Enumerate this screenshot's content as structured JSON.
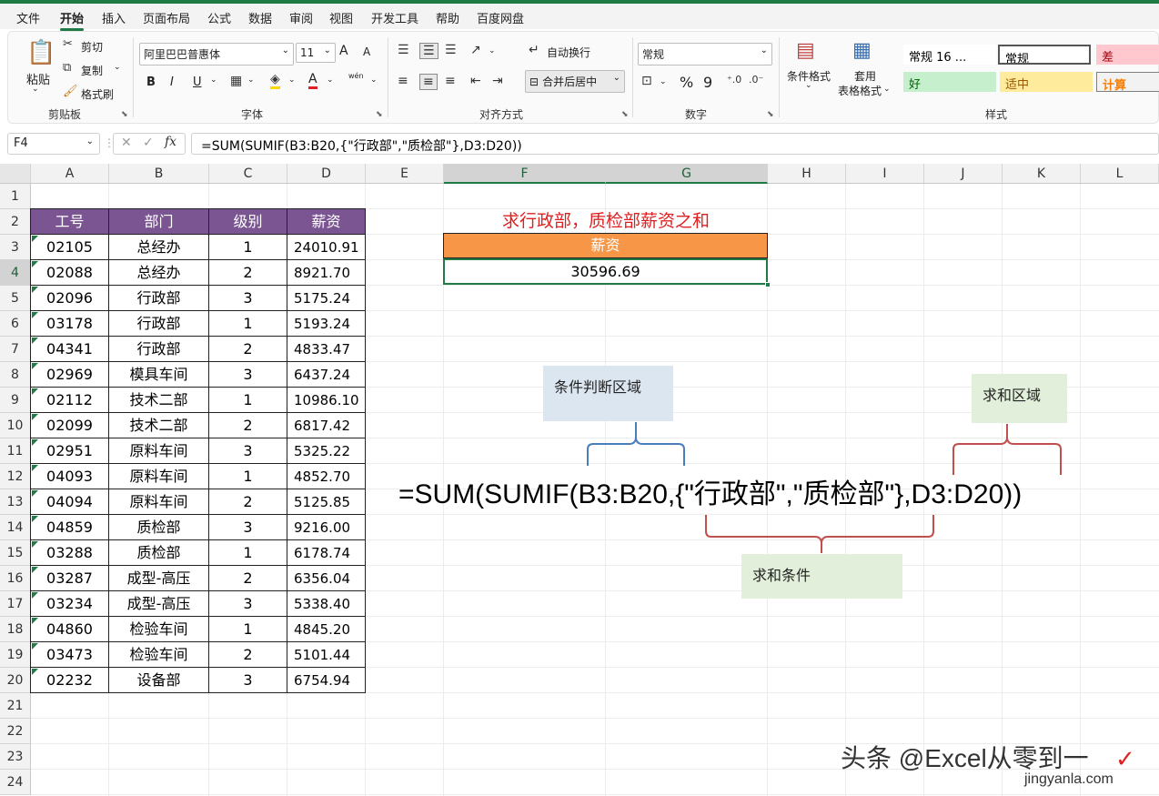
{
  "menu": [
    "文件",
    "开始",
    "插入",
    "页面布局",
    "公式",
    "数据",
    "审阅",
    "视图",
    "开发工具",
    "帮助",
    "百度网盘"
  ],
  "ribbon": {
    "clipboard": {
      "paste": "粘贴",
      "cut": "剪切",
      "copy": "复制",
      "format_painter": "格式刷",
      "label": "剪贴板"
    },
    "font": {
      "family": "阿里巴巴普惠体",
      "size": "11",
      "grow": "A",
      "shrink": "A",
      "bold": "B",
      "italic": "I",
      "underline": "U",
      "font_color_letter": "A",
      "phonetic": "wén",
      "label": "字体"
    },
    "alignment": {
      "wrap": "自动换行",
      "merge": "合并后居中",
      "label": "对齐方式"
    },
    "number": {
      "format": "常规",
      "percent": "%",
      "comma": "9",
      "label": "数字"
    },
    "styles": {
      "conditional": "条件格式",
      "table_fmt_1": "套用",
      "table_fmt_2": "表格格式",
      "cells": [
        {
          "text": "常规 16 ...",
          "bg": "#ffffff",
          "color": "#000000"
        },
        {
          "text": "常规",
          "bg": "#ffffff",
          "color": "#000000"
        },
        {
          "text": "差",
          "bg": "#ffc7ce",
          "color": "#9c0006"
        },
        {
          "text": "好",
          "bg": "#c6efce",
          "color": "#006100"
        },
        {
          "text": "适中",
          "bg": "#ffeb9c",
          "color": "#9c5700"
        },
        {
          "text": "计算",
          "bg": "#f2f2f2",
          "color": "#fa7d00"
        }
      ],
      "label": "样式"
    }
  },
  "formula_bar": {
    "name_box": "F4",
    "fx": "fx",
    "formula": "=SUM(SUMIF(B3:B20,{\"行政部\",\"质检部\"},D3:D20))"
  },
  "columns": [
    "A",
    "B",
    "C",
    "D",
    "E",
    "F",
    "G",
    "H",
    "I",
    "J",
    "K",
    "L"
  ],
  "rows": [
    "1",
    "2",
    "3",
    "4",
    "5",
    "6",
    "7",
    "8",
    "9",
    "10",
    "11",
    "12",
    "13",
    "14",
    "15",
    "16",
    "17",
    "18",
    "19",
    "20",
    "21",
    "22",
    "23",
    "24"
  ],
  "table": {
    "headers": [
      "工号",
      "部门",
      "级别",
      "薪资"
    ],
    "rows": [
      [
        "02105",
        "总经办",
        "1",
        "24010.91"
      ],
      [
        "02088",
        "总经办",
        "2",
        "8921.70"
      ],
      [
        "02096",
        "行政部",
        "3",
        "5175.24"
      ],
      [
        "03178",
        "行政部",
        "1",
        "5193.24"
      ],
      [
        "04341",
        "行政部",
        "2",
        "4833.47"
      ],
      [
        "02969",
        "模具车间",
        "3",
        "6437.24"
      ],
      [
        "02112",
        "技术二部",
        "1",
        "10986.10"
      ],
      [
        "02099",
        "技术二部",
        "2",
        "6817.42"
      ],
      [
        "02951",
        "原料车间",
        "3",
        "5325.22"
      ],
      [
        "04093",
        "原料车间",
        "1",
        "4852.70"
      ],
      [
        "04094",
        "原料车间",
        "2",
        "5125.85"
      ],
      [
        "04859",
        "质检部",
        "3",
        "9216.00"
      ],
      [
        "03288",
        "质检部",
        "1",
        "6178.74"
      ],
      [
        "03287",
        "成型-高压",
        "2",
        "6356.04"
      ],
      [
        "03234",
        "成型-高压",
        "3",
        "5338.40"
      ],
      [
        "04860",
        "检验车间",
        "1",
        "4845.20"
      ],
      [
        "03473",
        "检验车间",
        "2",
        "5101.44"
      ],
      [
        "02232",
        "设备部",
        "3",
        "6754.94"
      ]
    ]
  },
  "result": {
    "title": "求行政部，质检部薪资之和",
    "header": "薪资",
    "value": "30596.69"
  },
  "annotations": {
    "range": "条件判断区域",
    "sum_range": "求和区域",
    "criteria": "求和条件",
    "formula": "=SUM(SUMIF(B3:B20,{\"行政部\",\"质检部\"},D3:D20))"
  },
  "watermark": {
    "line1": "头条 @Excel从零到一",
    "line2": "jingyanla.com"
  },
  "colors": {
    "header_purple": "#7b5592",
    "orange": "#f79646",
    "excel_green": "#1f7a45",
    "red": "#e02020"
  }
}
